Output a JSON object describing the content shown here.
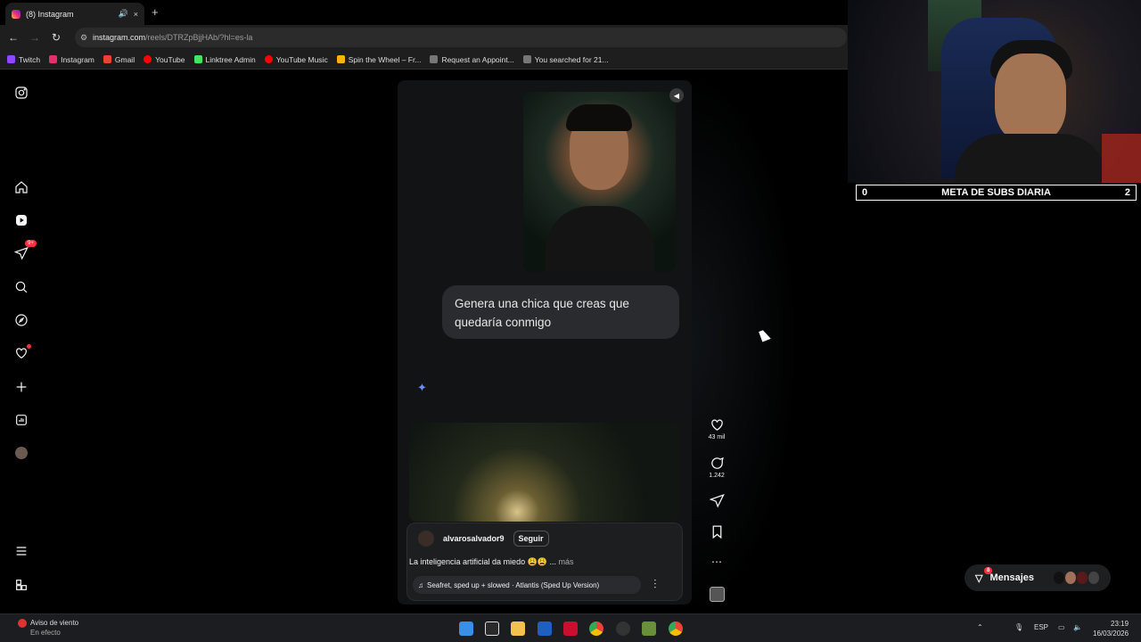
{
  "browser": {
    "tab_title": "(8) Instagram",
    "tab_audio_icon": "speaker-icon",
    "tab_close": "×",
    "new_tab": "+",
    "url_host": "instagram.com",
    "url_path": "/reels/DTRZpBjjHAb/?hl=es-la",
    "bookmarks": [
      {
        "label": "Twitch",
        "color": "#9146ff"
      },
      {
        "label": "Instagram",
        "color": "#e1306c"
      },
      {
        "label": "Gmail",
        "color": "#ea4335"
      },
      {
        "label": "YouTube",
        "color": "#ff0000"
      },
      {
        "label": "Linktree Admin",
        "color": "#43e660"
      },
      {
        "label": "YouTube Music",
        "color": "#ff0000"
      },
      {
        "label": "Spin the Wheel – Fr...",
        "color": "#f4b400"
      },
      {
        "label": "Request an Appoint...",
        "color": "#777777"
      },
      {
        "label": "You searched for 21...",
        "color": "#777777"
      }
    ]
  },
  "sidebar": {
    "notifications_badge": "9+"
  },
  "reel": {
    "prompt": "Genera una chica que creas que quedaría conmigo",
    "username": "alvarosalvador9",
    "follow_label": "Seguir",
    "caption": "La inteligencia artificial da miedo 😩😩 ...",
    "caption_more": "más",
    "music": "Seafret, sped up + slowed · Atlantis (Sped Up Version)",
    "likes": "43 mil",
    "comments": "1.242"
  },
  "stream": {
    "goal_left": "0",
    "goal_title": "META DE SUBS DIARIA",
    "goal_right": "2"
  },
  "messages": {
    "label": "Mensajes",
    "badge": "8"
  },
  "taskbar": {
    "weather_title": "Aviso de viento",
    "weather_sub": "En efecto",
    "lang": "ESP",
    "time": "23:19",
    "date": "16/03/2026"
  }
}
